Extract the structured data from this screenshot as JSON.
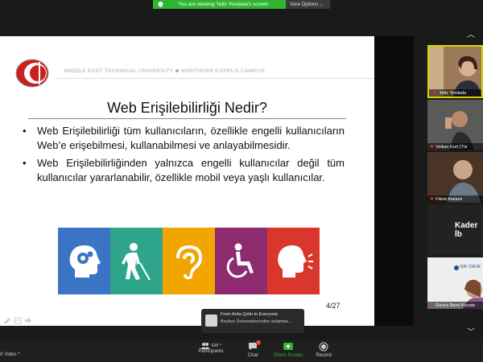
{
  "banner": {
    "viewing_text": "You are viewing Yeliz Yesilada's screen",
    "view_options": "View Options ⌄"
  },
  "slide": {
    "header": {
      "left": "MIDDLE EAST TECHNICAL UNIVERSITY",
      "right": "NORTHERN CYPRUS CAMPUS"
    },
    "title": "Web Erişilebilirliği Nedir?",
    "bullets": [
      "Web Erişilebilirliği tüm kullanıcıların, özellikle engelli kullanıcıların Web’e erişebilmesi, kullanabilmesi ve anlayabilmesidir.",
      "Web Erişilebilirliğinden yalnızca engelli kullanıcılar değil tüm kullanıcılar yararlanabilir, özellikle mobil veya yaşlı kullanıcılar."
    ],
    "bullet_symbol": "•",
    "icons": [
      {
        "name": "cognitive-head-icon",
        "color": "#3b74c4"
      },
      {
        "name": "blind-person-icon",
        "color": "#2ea58a"
      },
      {
        "name": "ear-icon",
        "color": "#f2a400"
      },
      {
        "name": "wheelchair-icon",
        "color": "#8e2a6e"
      },
      {
        "name": "speech-head-icon",
        "color": "#d9372b"
      }
    ],
    "page_number": "4/27"
  },
  "participants_videos": [
    {
      "name": "Yeliz Yesilada",
      "active": true
    },
    {
      "name": "Volkan Kurt (Tür",
      "active": false
    },
    {
      "name": "Fikret Atalanlı",
      "active": false
    },
    {
      "name": "Kader İb",
      "active": false
    },
    {
      "name": "Güneş Banu Kocate",
      "active": false
    }
  ],
  "chat_popup": {
    "from": "From Arda Çetin to Everyone",
    "message": "Beykoz Üniversitesi'nden selamlar..."
  },
  "toolbar": {
    "start_video": "rt Video",
    "participants_label": "Participants",
    "participants_count": "638",
    "chat_label": "Chat",
    "chat_badge": "7",
    "share_label": "Share Screen",
    "record_label": "Record",
    "share_color": "#2fb52f"
  }
}
